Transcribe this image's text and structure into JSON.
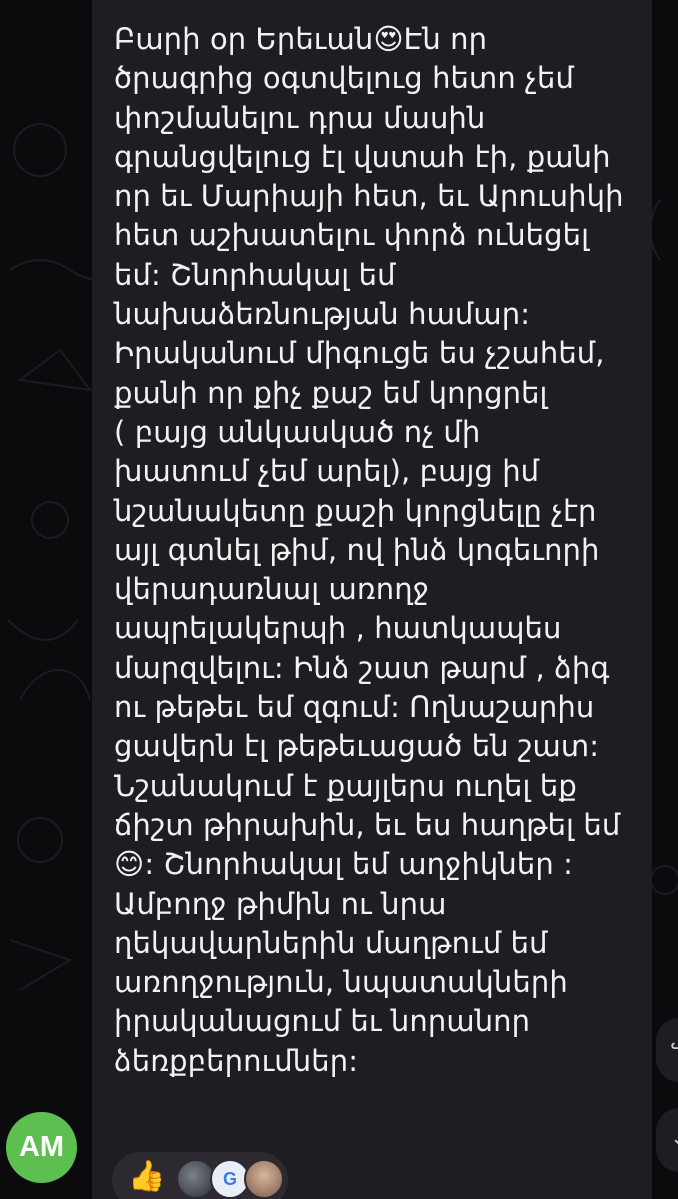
{
  "message": {
    "text": "Բարի օր Երեւան😍Էն որ\nծրագրից օգտվելուց հետո չեմ\nփոշմանելու դրա մասին\nգրանցվելուց էլ վստահ էի, քանի\nոր եւ Մարիայի հետ, եւ Արուսիկի\nհետ աշխատելու փորձ ունեցել\nեմ: Շնորհակալ եմ\nնախաձեռնության համար:\nԻրականում միգուցե ես չշահեմ,\nքանի որ քիչ քաշ եմ կորցրել\n( բայց անկասկած ոչ մի\nխատում չեմ արել), բայց իմ\nնշանակետը քաշի կորցնելը չէր\nայլ գտնել թիմ, ով ինձ կոգեւորի\nվերադառնալ առողջ\nապրելակերպի , հատկապես\nմարզվելու: Ինձ շատ թարմ , ձիգ\nու թեթեւ եմ զգում: Ողնաշարիս\nցավերն էլ թեթեւացած են շատ:\nՆշանակում է քայլերս ուղել եք\nճիշտ թիրախին, եւ ես հաղթել եմ\n😊: Շնորհակալ եմ աղջիկներ :\nԱմբողջ թիմին ու նրա\nղեկավարներին մաղթում եմ\nառողջություն, նպատակների\nիրականացում եւ նորանոր\nձեռքբերումներ:"
  },
  "sender": {
    "avatar_initials": "AM",
    "avatar_color": "#5cbf4f"
  },
  "reactions": {
    "emoji": "👍",
    "reactor_badge": "G"
  },
  "colors": {
    "background": "#0b0b0d",
    "bubble": "#1f1d22",
    "text": "#f2f2f2"
  }
}
